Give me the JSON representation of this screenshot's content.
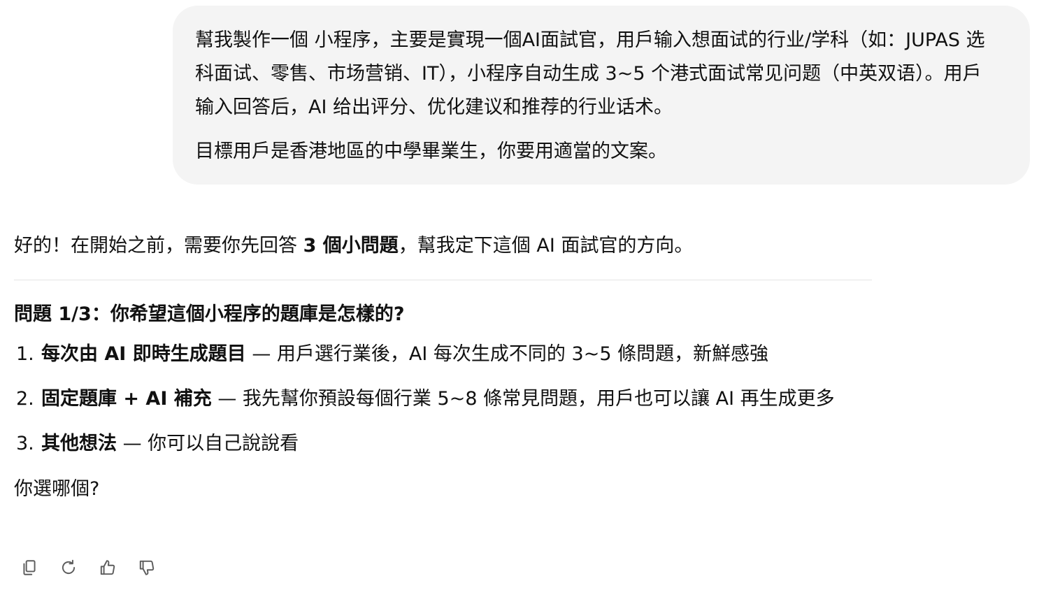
{
  "user_message": {
    "paragraph_1": "幫我製作一個 小程序，主要是實現一個AI面試官，用戶输入想面试的行业/学科（如：JUPAS 选科面试、零售、市场营销、IT），小程序自动生成 3~5 个港式面试常见问题（中英双语）。用戶输入回答后，AI 给出评分、优化建议和推荐的行业话术。",
    "paragraph_2": "目標用戶是香港地區的中學畢業生，你要用適當的文案。"
  },
  "assistant_message": {
    "intro_prefix": "好的！在開始之前，需要你先回答 ",
    "intro_bold": "3 個小問題",
    "intro_suffix": "，幫我定下這個 AI 面試官的方向。",
    "question_title": "問題 1/3：你希望這個小程序的題庫是怎樣的?",
    "options": [
      {
        "number": "1.",
        "bold": "每次由 AI 即時生成題目",
        "text": " — 用戶選行業後，AI 每次生成不同的 3~5 條問題，新鮮感強"
      },
      {
        "number": "2.",
        "bold": "固定題庫 + AI 補充",
        "text": " — 我先幫你預設每個行業 5~8 條常見問題，用戶也可以讓 AI 再生成更多"
      },
      {
        "number": "3.",
        "bold": "其他想法",
        "text": " — 你可以自己說說看"
      }
    ],
    "closing": "你選哪個?"
  },
  "actions": {
    "icons": [
      "copy-icon",
      "regenerate-icon",
      "thumbs-up-icon",
      "thumbs-down-icon"
    ],
    "icon_color": "#5d5d5d"
  },
  "colors": {
    "user_bubble_bg": "#f4f4f4",
    "text": "#111111",
    "divider": "#e5e5e5"
  }
}
